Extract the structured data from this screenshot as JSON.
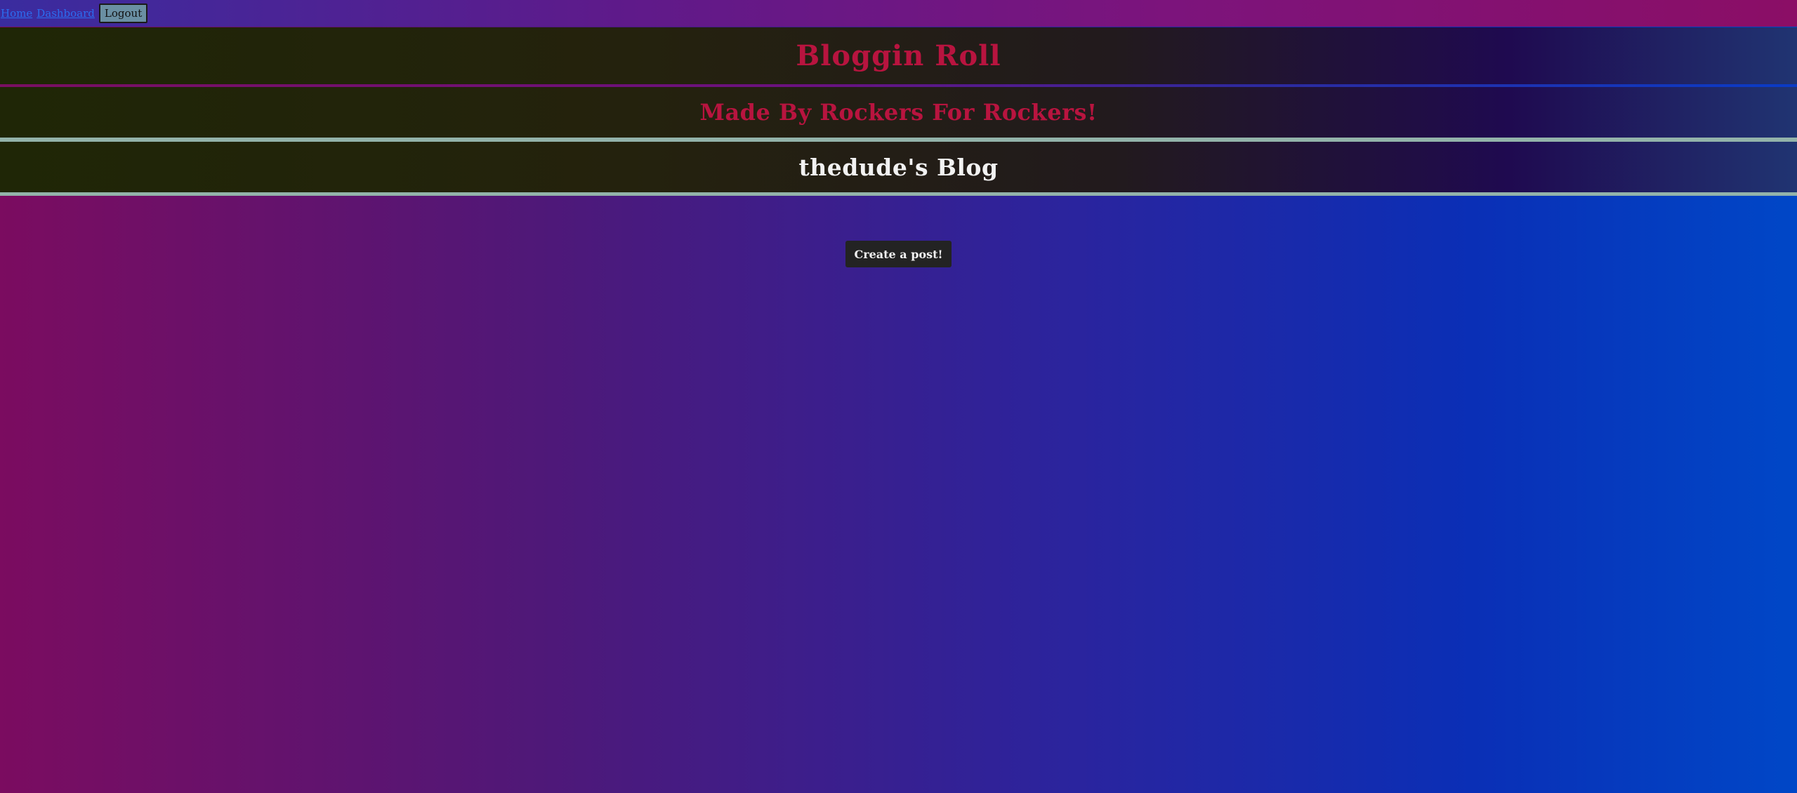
{
  "nav": {
    "home_label": "Home",
    "dashboard_label": "Dashboard",
    "logout_label": "Logout"
  },
  "header": {
    "site_title": "Bloggin Roll",
    "tagline": "Made By Rockers For Rockers!",
    "blog_heading": "thedude's Blog"
  },
  "main": {
    "create_post_label": "Create a post!"
  },
  "colors": {
    "title_red": "#b8143f",
    "heading_white": "#f2f2f2",
    "button_dark": "#232323",
    "rule_teal": "#93b3aa",
    "link_blue": "#2b6df0"
  }
}
